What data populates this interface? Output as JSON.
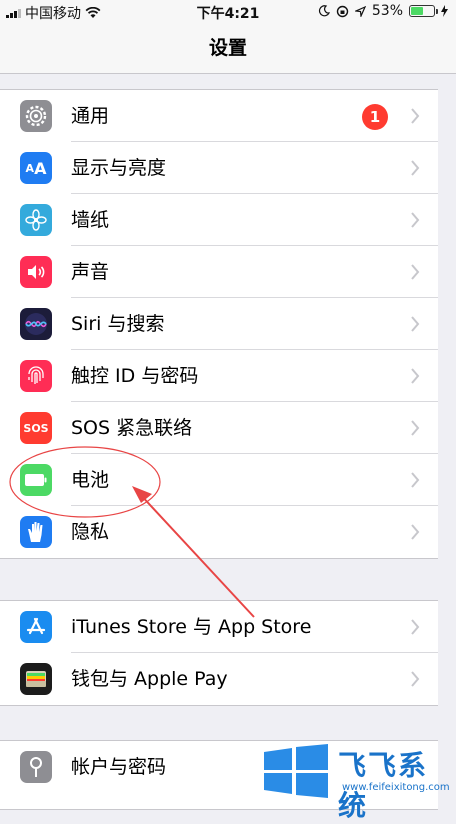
{
  "status_bar": {
    "carrier": "中国移动",
    "time": "下午4:21",
    "battery_percent": "53%",
    "battery_level": 0.53
  },
  "nav": {
    "title": "设置"
  },
  "group1": {
    "items": [
      {
        "label": "通用",
        "icon": "gear-icon",
        "color": "#8e8e93",
        "badge": "1"
      },
      {
        "label": "显示与亮度",
        "icon": "display-aa-icon",
        "color": "#1f7cf2"
      },
      {
        "label": "墙纸",
        "icon": "wallpaper-flower-icon",
        "color": "#34aadc"
      },
      {
        "label": "声音",
        "icon": "speaker-icon",
        "color": "#ff2d55"
      },
      {
        "label": "Siri 与搜索",
        "icon": "siri-icon",
        "color": "#1c1c3a"
      },
      {
        "label": "触控 ID 与密码",
        "icon": "fingerprint-icon",
        "color": "#ff2d55"
      },
      {
        "label": "SOS 紧急联络",
        "icon": "sos-icon",
        "color": "#ff3b30",
        "icon_text": "SOS"
      },
      {
        "label": "电池",
        "icon": "battery-icon",
        "color": "#4cd964"
      },
      {
        "label": "隐私",
        "icon": "hand-icon",
        "color": "#1f7cf2"
      }
    ]
  },
  "group2": {
    "items": [
      {
        "label": "iTunes Store 与 App Store",
        "icon": "app-store-icon",
        "color": "#1a8cf0"
      },
      {
        "label": "钱包与 Apple Pay",
        "icon": "wallet-icon",
        "color": "#1c1c1c"
      }
    ]
  },
  "group3": {
    "items": [
      {
        "label": "帐户与密码",
        "icon": "key-icon",
        "color": "#8e8e93"
      }
    ]
  },
  "watermark": {
    "name": "飞飞系统",
    "url": "www.feifeixitong.com",
    "color": "#1a73c9"
  },
  "annotation": {
    "color": "#e84545"
  }
}
